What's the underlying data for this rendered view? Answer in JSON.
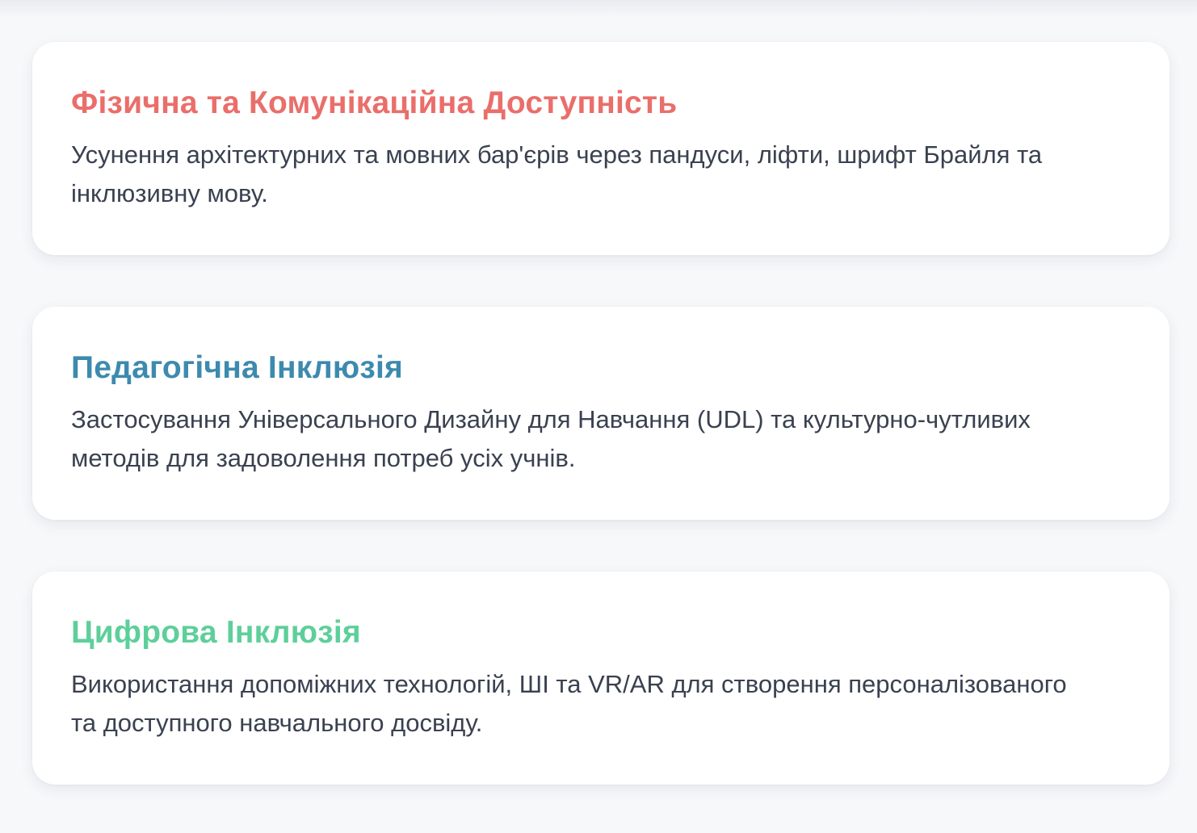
{
  "cards": [
    {
      "title": "Фізична та Комунікаційна Доступність",
      "description": "Усунення архітектурних та мовних бар'єрів через пандуси, ліфти, шрифт Брайля та інклюзивну мову.",
      "accent_color": "#ea6e6a"
    },
    {
      "title": "Педагогічна Інклюзія",
      "description": "Застосування Універсального Дизайну для Навчання (UDL) та культурно-чутливих методів для задоволення потреб усіх учнів.",
      "accent_color": "#3d8aae"
    },
    {
      "title": "Цифрова Інклюзія",
      "description": "Використання допоміжних технологій, ШІ та VR/AR для створення персоналізованого та доступного навчального досвіду.",
      "accent_color": "#5ecf9a"
    }
  ]
}
